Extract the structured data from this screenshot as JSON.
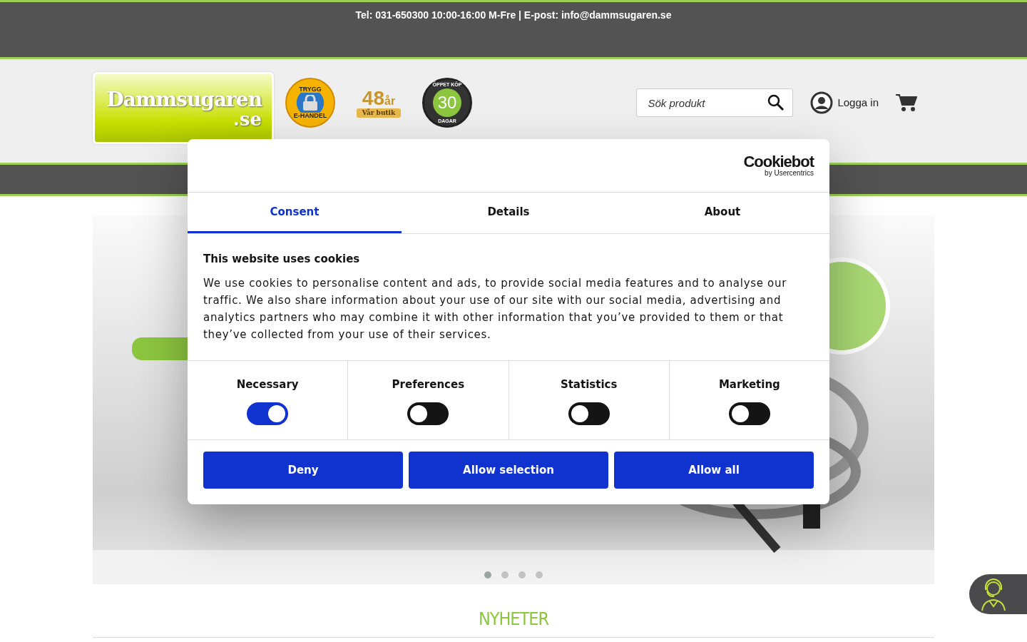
{
  "top_bar": {
    "contact": "Tel: 031-650300 10:00-16:00 M-Fre | E-post: info@dammsugaren.se"
  },
  "header": {
    "logo": {
      "name": "Dammsugaren",
      "tld": ".se"
    },
    "badges": [
      {
        "kind": "trygg",
        "top": "TRYGG",
        "bottom": "E-HANDEL"
      },
      {
        "kind": "years",
        "number": "48",
        "unit": "år",
        "ribbon": "Vår butik"
      },
      {
        "kind": "open",
        "top": "ÖPPET KÖP",
        "number": "30",
        "bottom": "DAGAR"
      }
    ],
    "search": {
      "placeholder": "Sök produkt"
    },
    "login": "Logga in"
  },
  "banner": {
    "kind": "picture",
    "dots": [
      {
        "selected": true
      },
      {
        "selected": false
      },
      {
        "selected": false
      },
      {
        "selected": false
      }
    ]
  },
  "section_heading": "NYHETER",
  "cookie_dialog": {
    "brand": "Cookiebot",
    "brand_sub": "by Usercentrics",
    "tabs": [
      {
        "label": "Consent",
        "selected": true
      },
      {
        "label": "Details",
        "selected": false
      },
      {
        "label": "About",
        "selected": false
      }
    ],
    "title": "This website uses cookies",
    "text": "We use cookies to personalise content and ads, to provide social media features and to analyse our traffic. We also share information about your use of our site with our social media, advertising and analytics partners who may combine it with other information that you’ve provided to them or that they’ve collected from your use of their services.",
    "categories": [
      {
        "label": "Necessary",
        "on": true
      },
      {
        "label": "Preferences",
        "on": false
      },
      {
        "label": "Statistics",
        "on": false
      },
      {
        "label": "Marketing",
        "on": false
      }
    ],
    "buttons": [
      "Deny",
      "Allow selection",
      "Allow all"
    ]
  }
}
